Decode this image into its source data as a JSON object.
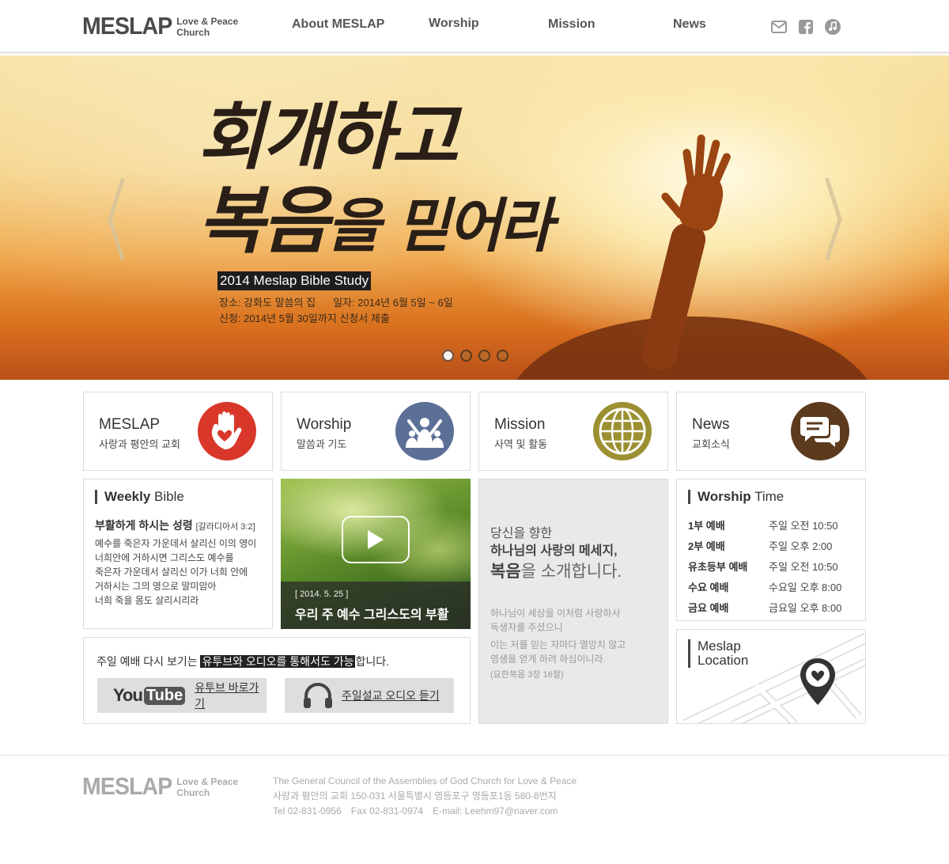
{
  "brand": {
    "name": "MESLAP",
    "sub1": "Love & Peace",
    "sub2": "Church"
  },
  "nav": [
    {
      "label": "About MESLAP"
    },
    {
      "label": "Worship"
    },
    {
      "label": "Mission"
    },
    {
      "label": "News"
    }
  ],
  "header_icons": [
    "mail-icon",
    "facebook-icon",
    "music-icon"
  ],
  "hero": {
    "title_line1": "회개하고",
    "title_line2a": "복음",
    "title_line2b": "을 믿어라",
    "badge": "2014 Meslap Bible Study",
    "place": "장소: 강화도 말씀의 집",
    "date": "일자: 2014년 6월 5일 ~ 6일",
    "apply": "신청: 2014년 5월 30일까지 신청서 제출",
    "slide_count": 4,
    "active_slide": 1
  },
  "tiles": [
    {
      "title": "MESLAP",
      "sub": "사랑과 평안의 교회",
      "icon": "hand-heart-icon",
      "color": "#d9372a"
    },
    {
      "title": "Worship",
      "sub": "말씀과 기도",
      "icon": "worship-people-icon",
      "color": "#5b6f97"
    },
    {
      "title": "Mission",
      "sub": "사역 및 활동",
      "icon": "globe-icon",
      "color": "#9c9032"
    },
    {
      "title": "News",
      "sub": "교회소식",
      "icon": "chat-bubbles-icon",
      "color": "#5c3a1c"
    }
  ],
  "weekly_bible": {
    "heading_bold": "Weekly",
    "heading_rest": " Bible",
    "verse_title": "부활하게 하시는 성령",
    "verse_ref": "[갈라디아서 3:2]",
    "lines": [
      "예수를 죽은자 가운데서 살리신 이의 영이",
      "너희안에 거하시면 그리스도 예수를",
      "죽은자 가운데서 살리신 이가 너희 안에",
      "거하시는 그의 영으로 말미암아",
      "너희 죽을 몸도 살리시리라"
    ]
  },
  "video": {
    "date": "[ 2014. 5. 25 ]",
    "title": "우리 주 예수 그리스도의 부활"
  },
  "message": {
    "line1": "당신을 향한",
    "line2": "하나님의 사랑의 메세지,",
    "line3_bold": "복음",
    "line3_rest": "을 소개합니다.",
    "para1": [
      "하나님이 세상을 이처럼 사랑하사",
      "독생자를 주셨으니"
    ],
    "para2": [
      "이는 저를 믿는 자마다 멸망치 않고",
      "영생을 얻게 하려 하심이니라."
    ],
    "ref": "(요한복음 3장 16절)"
  },
  "worship_time": {
    "heading_bold": "Worship",
    "heading_rest": " Time",
    "rows": [
      {
        "name": "1부 예배",
        "time": "주일 오전 10:50"
      },
      {
        "name": "2부 예배",
        "time": "주일 오후 2:00"
      },
      {
        "name": "유초등부 예배",
        "time": "주일 오전 10:50"
      },
      {
        "name": "수요 예배",
        "time": "수요일 오후 8:00"
      },
      {
        "name": "금요 예배",
        "time": "금요일 오후 8:00"
      }
    ]
  },
  "replay": {
    "text_before": "주일 예배 다시 보기는 ",
    "text_highlight": "유투브와 오디오를 통해서도 가능",
    "text_after": "합니다.",
    "youtube_logo_you": "You",
    "youtube_logo_tube": "Tube",
    "youtube_label": "유투브 바로가기",
    "audio_label": "주일설교 오디오 듣기"
  },
  "location": {
    "line1": "Meslap",
    "line2": "Location"
  },
  "footer": {
    "line1": "The General Council of the Assemblies of God Church for Love & Peace",
    "line2": "사랑과 평안의 교회 150-031 서울특별시 영등포구 영등포1동 580-8번지",
    "tel": "Tel 02-831-0956",
    "fax": "Fax 02-831-0974",
    "email": "E-mail: Leehm97@naver.com"
  }
}
